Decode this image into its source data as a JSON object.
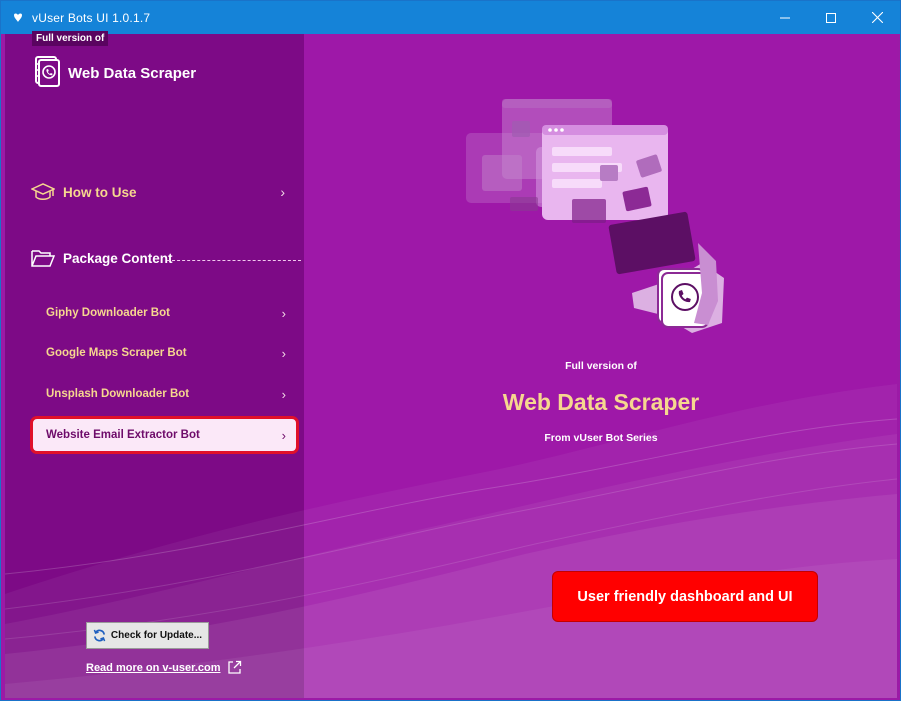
{
  "window": {
    "title": "vUser Bots UI 1.0.1.7",
    "controls": [
      "minimize",
      "maximize",
      "close"
    ]
  },
  "sidebar": {
    "badge": "Full version of",
    "product_title": "Web Data Scraper",
    "nav": [
      {
        "label": "How to Use",
        "icon": "graduation-cap-icon"
      },
      {
        "label": "Package Content",
        "icon": "folder-open-icon"
      }
    ],
    "package_items": [
      {
        "label": "Giphy Downloader Bot",
        "active": false
      },
      {
        "label": "Google Maps Scraper Bot",
        "active": false
      },
      {
        "label": "Unsplash Downloader Bot",
        "active": false
      },
      {
        "label": "Website Email Extractor Bot",
        "active": true
      }
    ],
    "update_button": "Check for Update...",
    "read_more": "Read more on v-user.com"
  },
  "main": {
    "caption_small": "Full version of",
    "caption_title": "Web Data Scraper",
    "caption_from": "From vUser Bot Series",
    "promo": "User friendly dashboard and UI"
  },
  "colors": {
    "titlebar": "#1583d8",
    "sidebar": "#7d0a86",
    "main": "#9e18a8",
    "accent_yellow": "#f6d78f",
    "highlight_red": "#e0102a"
  }
}
